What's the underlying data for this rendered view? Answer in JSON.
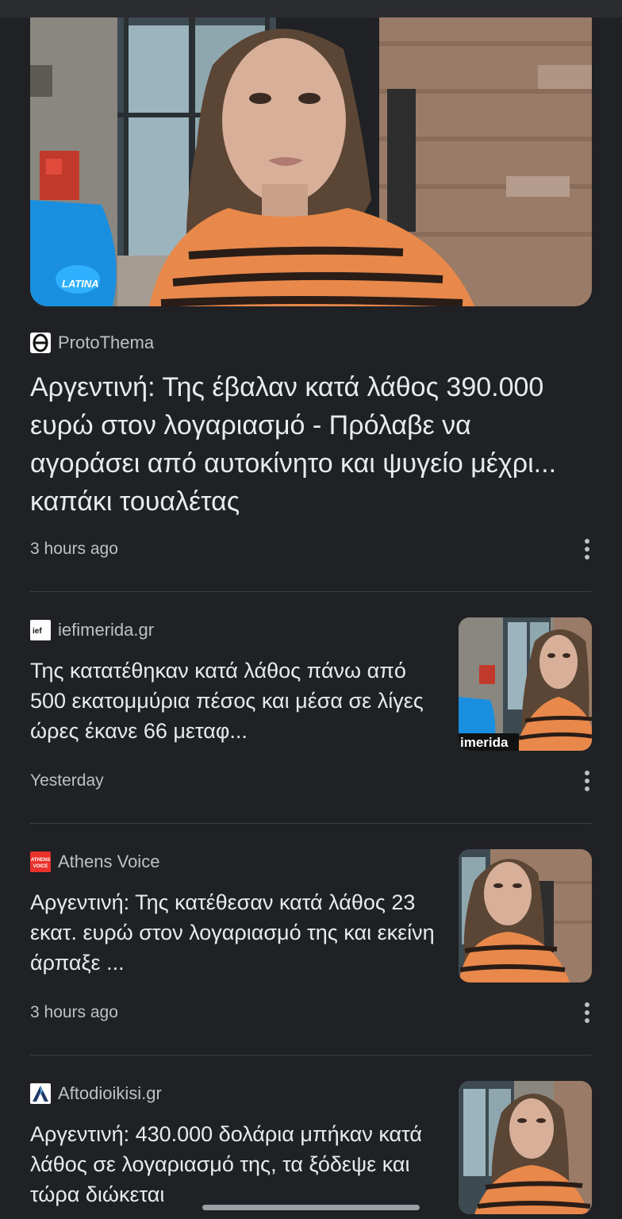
{
  "articles": [
    {
      "source": "ProtoThema",
      "source_logo": "theta-logo-icon",
      "headline": "Αργεντινή: Της έβαλαν κατά λάθος 390.000 ευρώ στον λογαριασμό - Πρόλαβε να αγοράσει από αυτοκίνητο και ψυγείο μέχρι... καπάκι τουαλέτας",
      "time": "3 hours ago"
    },
    {
      "source": "iefimerida.gr",
      "source_logo_text": "ief",
      "headline": "Της κατατέθηκαν κατά λάθος πάνω από 500 εκατομμύρια πέσος και μέσα σε λίγες ώρες έκανε 66 μεταφ...",
      "time": "Yesterday",
      "thumb_watermark": "imerida"
    },
    {
      "source": "Athens Voice",
      "source_logo_text_1": "ATHENS",
      "source_logo_text_2": "VOICE",
      "headline": "Αργεντινή: Της κατέθεσαν κατά λάθος 23 εκατ. ευρώ στον λογαριασμό της και εκείνη άρπαξε ...",
      "time": "3 hours ago"
    },
    {
      "source": "Aftodioikisi.gr",
      "source_logo": "triangle-a-logo-icon",
      "headline": "Αργεντινή: 430.000 δολάρια μπήκαν κατά λάθος σε λογαριασμό της, τα ξόδεψε και τώρα διώκεται"
    }
  ],
  "colors": {
    "background": "#202124",
    "text_primary": "#e8eaed",
    "text_secondary": "#bdc1c6",
    "divider": "#3c4043",
    "sweater_orange": "#e8884a",
    "mic_blue": "#1a8fe0"
  },
  "icons": {
    "more": "more-vert-icon"
  }
}
